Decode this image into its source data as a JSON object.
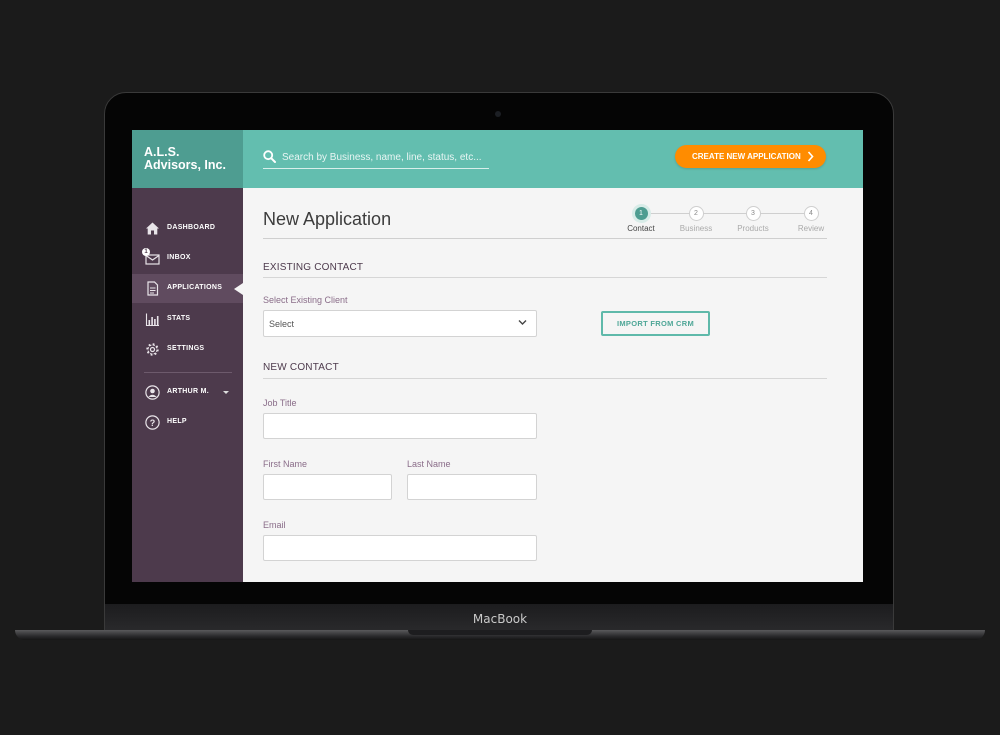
{
  "device": {
    "label": "MacBook"
  },
  "brand": {
    "line1": "A.L.S.",
    "line2": "Advisors, Inc."
  },
  "search": {
    "placeholder": "Search by Business, name, line, status, etc..."
  },
  "header": {
    "create_label": "CREATE NEW APPLICATION"
  },
  "sidebar": {
    "items": [
      {
        "label": "DASHBOARD",
        "icon": "home-icon"
      },
      {
        "label": "INBOX",
        "icon": "inbox-icon",
        "badge": "1"
      },
      {
        "label": "APPLICATIONS",
        "icon": "document-icon",
        "active": true
      },
      {
        "label": "STATS",
        "icon": "bar-chart-icon"
      },
      {
        "label": "SETTINGS",
        "icon": "gear-icon"
      }
    ],
    "user": {
      "label": "ARTHUR M.",
      "icon": "user-avatar-icon"
    },
    "help": {
      "label": "HELP",
      "icon": "help-icon"
    }
  },
  "page": {
    "title": "New Application"
  },
  "stepper": {
    "steps": [
      {
        "number": "1",
        "label": "Contact",
        "active": true
      },
      {
        "number": "2",
        "label": "Business"
      },
      {
        "number": "3",
        "label": "Products"
      },
      {
        "number": "4",
        "label": "Review"
      }
    ]
  },
  "existing_contact": {
    "title": "EXISTING CONTACT",
    "select_label": "Select Existing Client",
    "select_value": "Select",
    "import_label": "IMPORT FROM CRM"
  },
  "new_contact": {
    "title": "NEW CONTACT",
    "job_title_label": "Job Title",
    "first_name_label": "First Name",
    "last_name_label": "Last Name",
    "email_label": "Email"
  },
  "colors": {
    "teal": "#63beaf",
    "teal_dark": "#4e9d91",
    "orange": "#ff8c00",
    "sidebar": "#4d3a4c"
  }
}
